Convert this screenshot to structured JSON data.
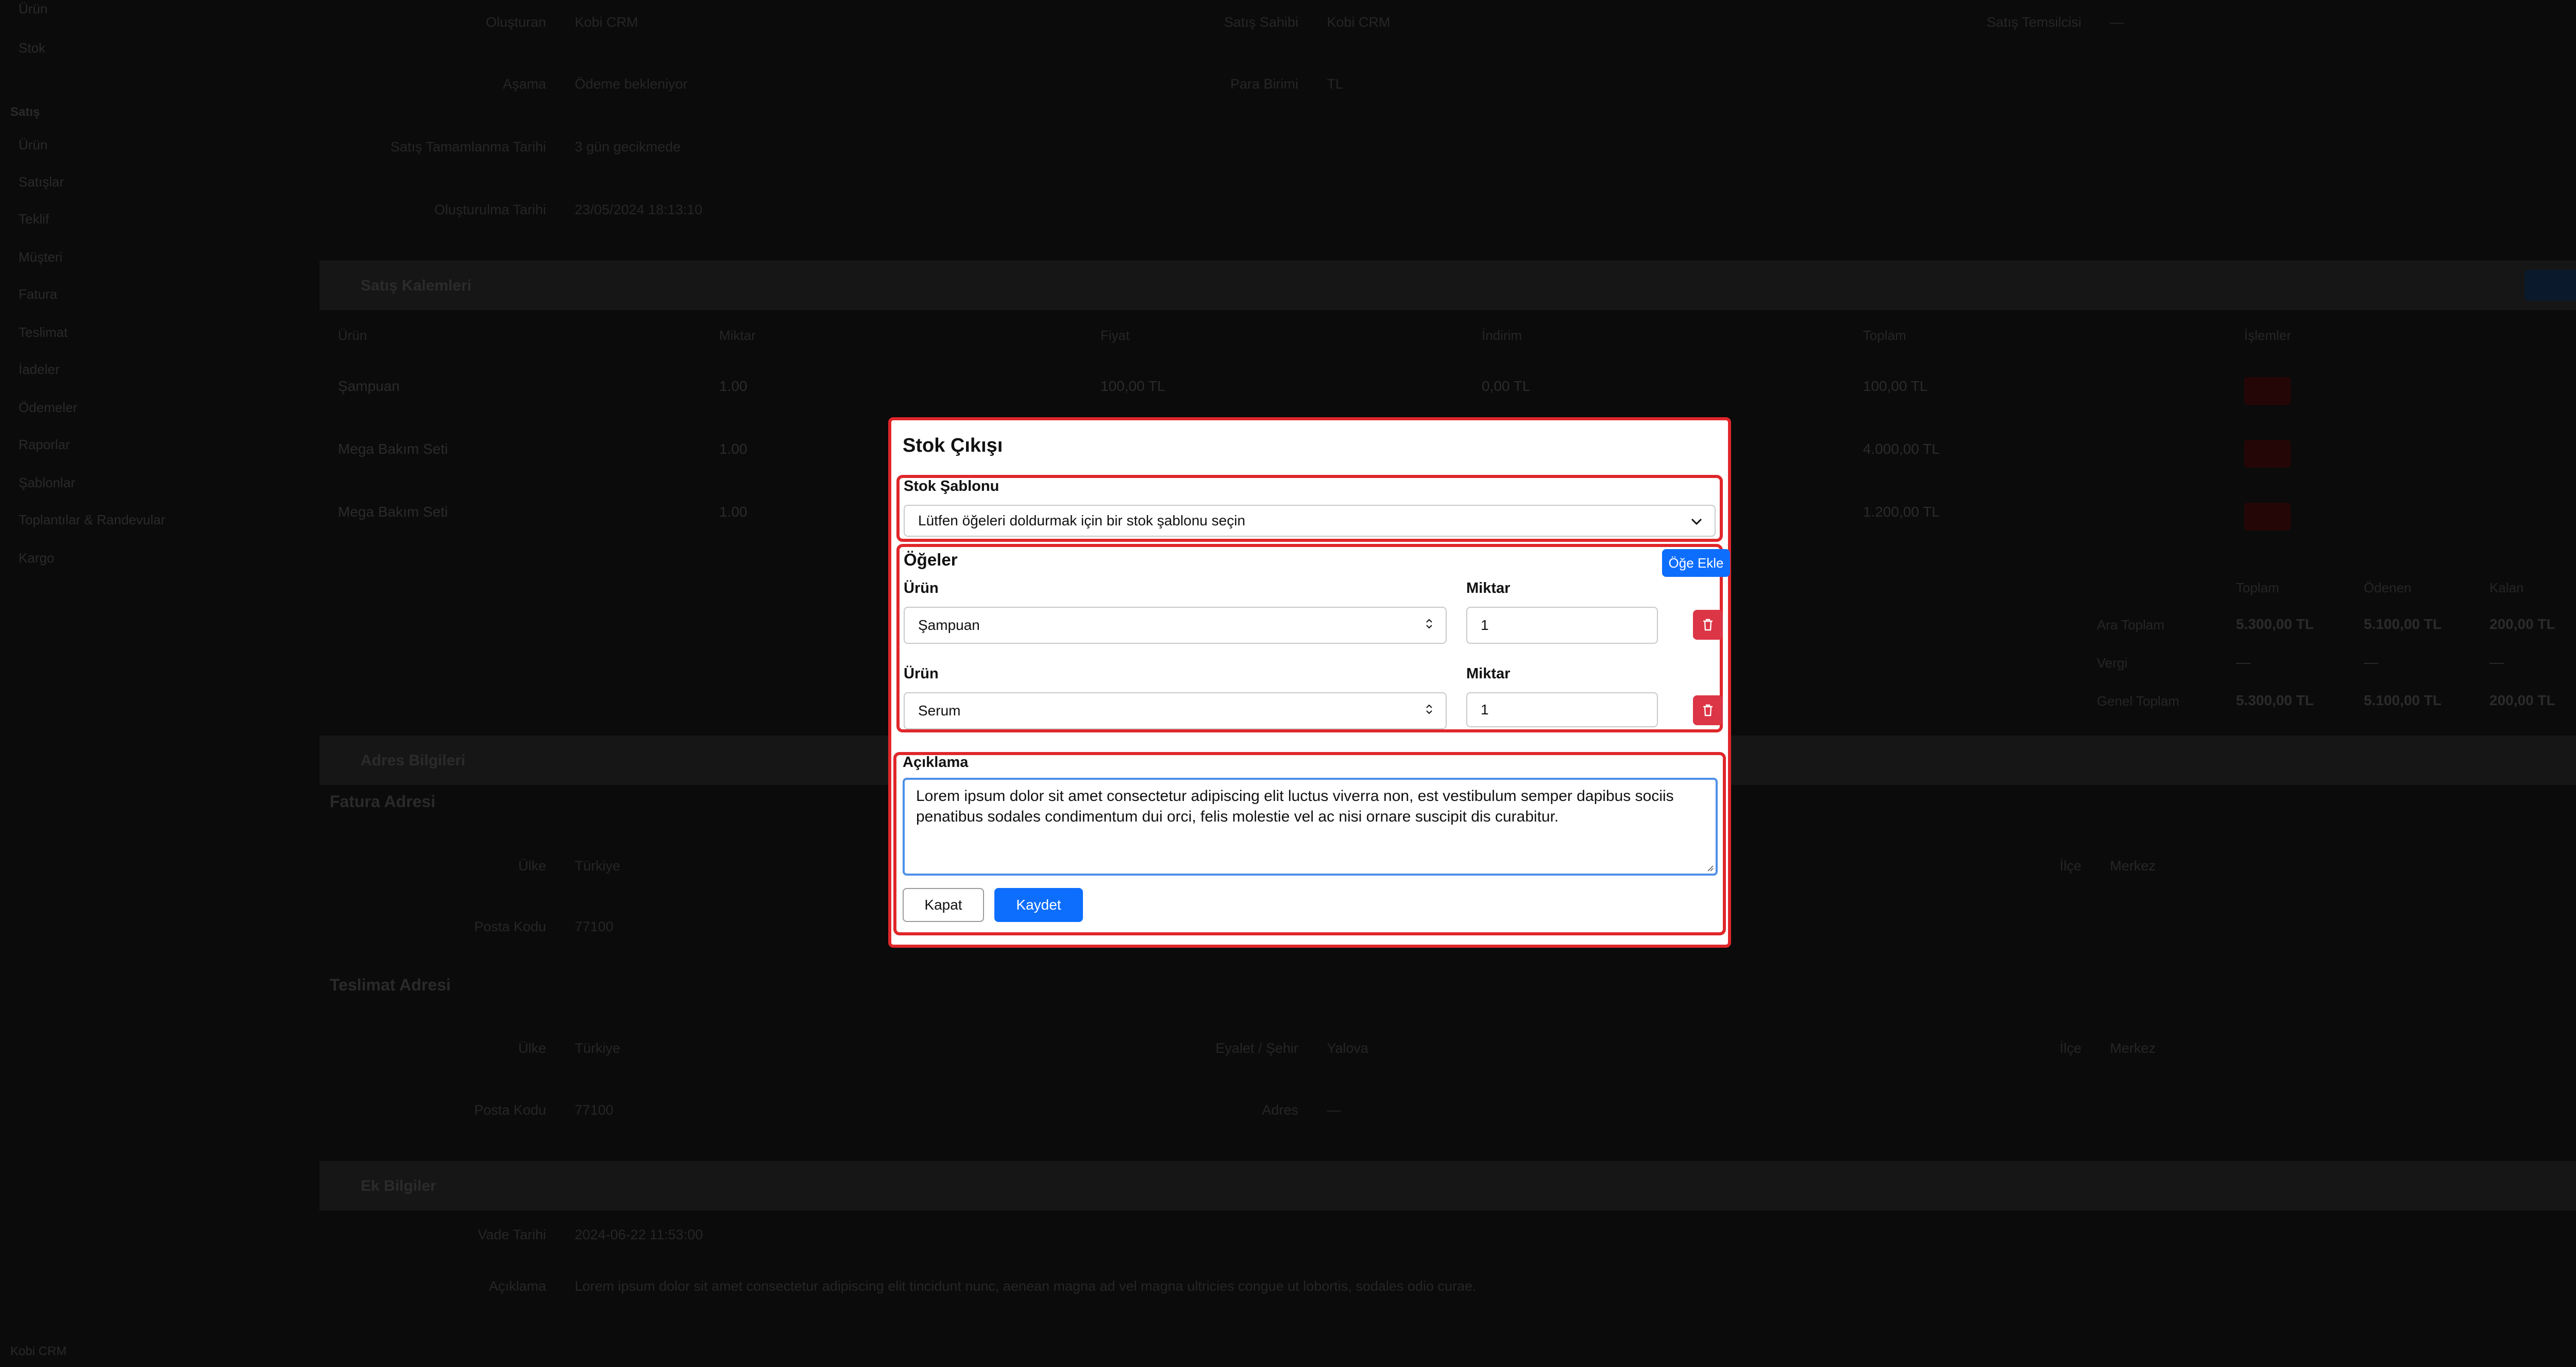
{
  "background": {
    "sidebar": {
      "items_top": [
        "Ürün",
        "Stok"
      ],
      "group": "Satış",
      "items": [
        "Ürün",
        "Satışlar",
        "Teklif",
        "Müşteri",
        "Fatura",
        "Teslimat",
        "İadeler",
        "Ödemeler",
        "Raporlar",
        "Şablonlar",
        "Toplantılar & Randevular",
        "Kargo"
      ],
      "footer": "Kobi CRM"
    },
    "info": [
      {
        "k": "Oluşturan",
        "v": "Kobi CRM"
      },
      {
        "k": "Satış Sahibi",
        "v": "Kobi CRM"
      },
      {
        "k": "Satış Temsilcisi",
        "v": "—"
      },
      {
        "k": "Aşama",
        "v": "Ödeme bekleniyor"
      },
      {
        "k": "Para Birimi",
        "v": "TL"
      },
      {
        "k": "Satış Tamamlanma Tarihi",
        "v": "3 gün gecikmede"
      },
      {
        "k": "Oluşturulma Tarihi",
        "v": "23/05/2024 18:13:10"
      }
    ],
    "products_section": {
      "title": "Satış Kalemleri",
      "columns": [
        "Ürün",
        "Miktar",
        "Fiyat",
        "İndirim",
        "Toplam",
        "İşlemler"
      ],
      "rows": [
        {
          "product": "Şampuan",
          "qty": "1.00",
          "price": "100,00 TL",
          "discount": "0,00 TL",
          "total": "100,00 TL"
        },
        {
          "product": "Mega Bakım Seti",
          "qty": "1.00",
          "price": "",
          "discount": "",
          "total": "4.000,00 TL"
        },
        {
          "product": "Mega Bakım Seti",
          "qty": "1.00",
          "price": "",
          "discount": "",
          "total": "1.200,00 TL"
        }
      ],
      "totals_header": [
        "Toplam",
        "Ödenen",
        "Kalan"
      ],
      "totals_rows": [
        {
          "label": "Ara Toplam",
          "values": [
            "5.300,00 TL",
            "5.100,00 TL",
            "200,00 TL"
          ]
        },
        {
          "label": "Vergi",
          "values": [
            "—",
            "—",
            "—"
          ]
        },
        {
          "label": "Genel Toplam",
          "values": [
            "5.300,00 TL",
            "5.100,00 TL",
            "200,00 TL"
          ]
        }
      ]
    },
    "address_section": {
      "title": "Adres Bilgileri",
      "billing_title": "Fatura Adresi",
      "shipping_title": "Teslimat Adresi",
      "billing": [
        {
          "k": "Ülke",
          "v": "Türkiye"
        },
        {
          "k": "İlçe",
          "v": "Merkez"
        },
        {
          "k": "Posta Kodu",
          "v": "77100"
        }
      ],
      "shipping": [
        {
          "k": "Ülke",
          "v": "Türkiye"
        },
        {
          "k": "Eyalet / Şehir",
          "v": "Yalova"
        },
        {
          "k": "İlçe",
          "v": "Merkez"
        },
        {
          "k": "Posta Kodu",
          "v": "77100"
        },
        {
          "k": "Adres",
          "v": "—"
        }
      ]
    },
    "extra_section": {
      "title": "Ek Bilgiler",
      "rows": [
        {
          "k": "Vade Tarihi",
          "v": "2024-06-22 11:53:00"
        },
        {
          "k": "Açıklama",
          "v": "Lorem ipsum dolor sit amet consectetur adipiscing elit tincidunt nunc, aenean magna ad vel magna ultricies congue ut lobortis, sodales odio curae."
        }
      ]
    }
  },
  "modal": {
    "title": "Stok Çıkışı",
    "template_label": "Stok Şablonu",
    "template_placeholder": "Lütfen öğeleri doldurmak için bir stok şablonu seçin",
    "items_title": "Öğeler",
    "add_item_label": "Öğe Ekle",
    "items": [
      {
        "product_label": "Ürün",
        "product": "Şampuan",
        "qty_label": "Miktar",
        "qty": "1"
      },
      {
        "product_label": "Ürün",
        "product": "Serum",
        "qty_label": "Miktar",
        "qty": "1"
      }
    ],
    "description_label": "Açıklama",
    "description": "Lorem ipsum dolor sit amet consectetur adipiscing elit luctus viverra non, est vestibulum semper dapibus sociis penatibus sodales condimentum dui orci, felis molestie vel ac nisi ornare suscipit dis curabitur.",
    "close_label": "Kapat",
    "save_label": "Kaydet"
  },
  "colors": {
    "primary": "#0d6efd",
    "danger": "#dc3545",
    "highlight": "#e0262a",
    "focus": "#4d8fe8",
    "overlay": "#000000"
  }
}
